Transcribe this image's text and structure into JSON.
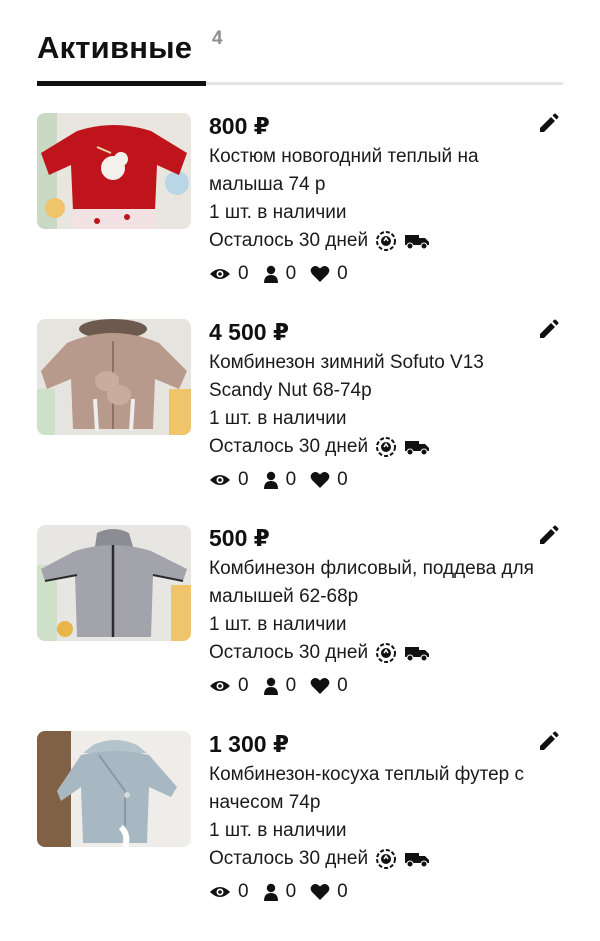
{
  "header": {
    "title": "Активные",
    "count": "4"
  },
  "listings": [
    {
      "price": "800 ₽",
      "title": "Костюм новогодний теплый на малыша 74 р",
      "stock": "1 шт. в наличии",
      "days_left": "Осталось 30 дней",
      "views": "0",
      "contacts": "0",
      "favorites": "0",
      "image": "red-christmas-sweater-photo"
    },
    {
      "price": "4 500 ₽",
      "title": "Комбинезон зимний Sofuto V13 Scandy Nut 68-74р",
      "stock": "1 шт. в наличии",
      "days_left": "Осталось 30 дней",
      "views": "0",
      "contacts": "0",
      "favorites": "0",
      "image": "beige-winter-overall-photo"
    },
    {
      "price": "500 ₽",
      "title": "Комбинезон флисовый, поддева для малышей 62-68р",
      "stock": "1 шт. в наличии",
      "days_left": "Осталось 30 дней",
      "views": "0",
      "contacts": "0",
      "favorites": "0",
      "image": "grey-fleece-overall-photo"
    },
    {
      "price": "1 300 ₽",
      "title": "Комбинезон-косуха теплый футер с начесом 74р",
      "stock": "1 шт. в наличии",
      "days_left": "Осталось 30 дней",
      "views": "0",
      "contacts": "0",
      "favorites": "0",
      "image": "light-blue-jacket-overall-photo"
    }
  ],
  "icons": {
    "edit": "pencil-icon",
    "delivery_safe": "safe-deal-badge-icon",
    "delivery": "truck-icon",
    "views": "eye-icon",
    "contacts": "person-icon",
    "favorites": "heart-icon"
  },
  "colors": {
    "text": "#111111",
    "muted": "#8e8e8e",
    "divider": "#e4e4e4"
  }
}
